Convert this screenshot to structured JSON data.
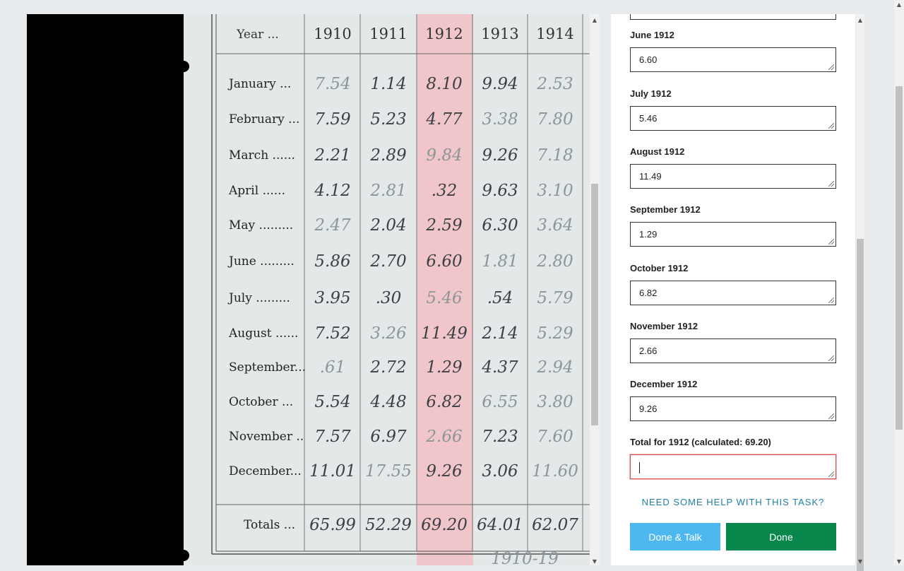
{
  "scan": {
    "years": [
      "Year ...",
      "1910",
      "1911",
      "1912",
      "1913",
      "1914"
    ],
    "rows": [
      {
        "month": "January ...",
        "values": [
          "7.54",
          "1.14",
          "8.10",
          "9.94",
          "2.53"
        ]
      },
      {
        "month": "February ...",
        "values": [
          "7.59",
          "5.23",
          "4.77",
          "3.38",
          "7.80"
        ]
      },
      {
        "month": "March ......",
        "values": [
          "2.21",
          "2.89",
          "9.84",
          "9.26",
          "7.18"
        ]
      },
      {
        "month": "April ......",
        "values": [
          "4.12",
          "2.81",
          ".32",
          "9.63",
          "3.10"
        ]
      },
      {
        "month": "May .........",
        "values": [
          "2.47",
          "2.04",
          "2.59",
          "6.30",
          "3.64"
        ]
      },
      {
        "month": "June .........",
        "values": [
          "5.86",
          "2.70",
          "6.60",
          "1.81",
          "2.80"
        ]
      },
      {
        "month": "July .........",
        "values": [
          "3.95",
          ".30",
          "5.46",
          ".54",
          "5.79"
        ]
      },
      {
        "month": "August ......",
        "values": [
          "7.52",
          "3.26",
          "11.49",
          "2.14",
          "5.29"
        ]
      },
      {
        "month": "September...",
        "values": [
          ".61",
          "2.72",
          "1.29",
          "4.37",
          "2.94"
        ]
      },
      {
        "month": "October ...",
        "values": [
          "5.54",
          "4.48",
          "6.82",
          "6.55",
          "3.80"
        ]
      },
      {
        "month": "November ..",
        "values": [
          "7.57",
          "6.97",
          "2.66",
          "7.23",
          "7.60"
        ]
      },
      {
        "month": "December...",
        "values": [
          "11.01",
          "17.55",
          "9.26",
          "3.06",
          "11.60"
        ]
      }
    ],
    "totals_label": "Totals ...",
    "totals": [
      "65.99",
      "52.29",
      "69.20",
      "64.01",
      "62.07"
    ],
    "footer_note": "1910-19"
  },
  "form": {
    "fields": [
      {
        "label": "June 1912",
        "value": "6.60"
      },
      {
        "label": "July 1912",
        "value": "5.46"
      },
      {
        "label": "August 1912",
        "value": "11.49"
      },
      {
        "label": "September 1912",
        "value": "1.29"
      },
      {
        "label": "October 1912",
        "value": "6.82"
      },
      {
        "label": "November 1912",
        "value": "2.66"
      },
      {
        "label": "December 1912",
        "value": "9.26"
      }
    ],
    "total_label": "Total for 1912 (calculated: 69.20)",
    "total_value": "",
    "help_text": "NEED SOME HELP WITH THIS TASK?",
    "done_talk_label": "Done & Talk",
    "done_label": "Done"
  },
  "colors": {
    "highlight_column": "#f2c7cb",
    "done_talk": "#4db8f0",
    "done": "#07874c",
    "help_link": "#1f7fa6",
    "active_border": "#d9534f"
  }
}
